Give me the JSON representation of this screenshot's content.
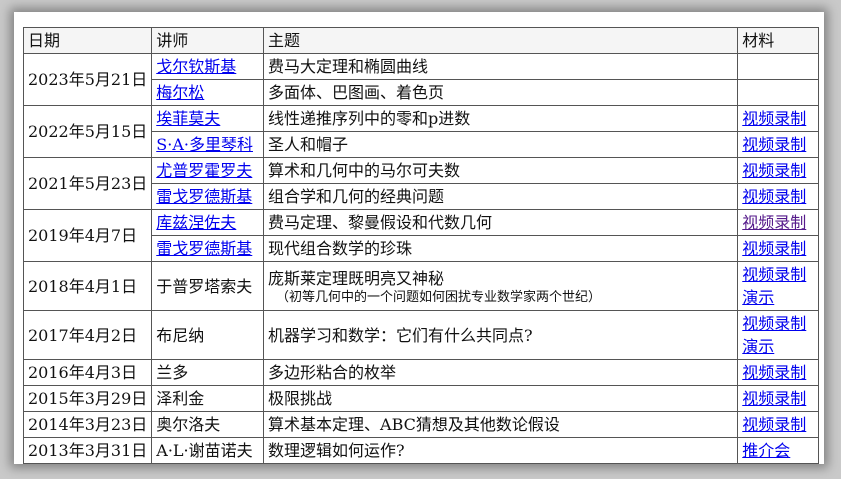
{
  "headers": {
    "date": "日期",
    "lecturer": "讲师",
    "topic": "主题",
    "material": "材料"
  },
  "rows": [
    {
      "date": "2023年5月21日",
      "lecturer": "戈尔钦斯基",
      "topic": "费马大定理和椭圆曲线",
      "material": ""
    },
    {
      "lecturer": "梅尔松",
      "topic": "多面体、巴图画、着色页",
      "material": ""
    },
    {
      "date": "2022年5月15日",
      "lecturer": "埃菲莫夫",
      "topic": "线性递推序列中的零和p进数",
      "material": "视频录制"
    },
    {
      "lecturer": "S·A·多里琴科",
      "topic": "圣人和帽子",
      "material": "视频录制"
    },
    {
      "date": "2021年5月23日",
      "lecturer": "尤普罗霍罗夫",
      "topic": "算术和几何中的马尔可夫数",
      "material": "视频录制"
    },
    {
      "lecturer": "雷戈罗德斯基",
      "topic": "组合学和几何的经典问题",
      "material": "视频录制"
    },
    {
      "date": "2019年4月7日",
      "lecturer": "库兹涅佐夫",
      "topic": "费马定理、黎曼假设和代数几何",
      "material": "视频录制"
    },
    {
      "lecturer": "雷戈罗德斯基",
      "topic": "现代组合数学的珍珠",
      "material": "视频录制"
    },
    {
      "date": "2018年4月1日",
      "lecturer": "于普罗塔索夫",
      "topic": "庞斯莱定理既明亮又神秘",
      "topic_sub": "（初等几何中的一个问题如何困扰专业数学家两个世纪）",
      "material": "视频录制",
      "material2": "演示"
    },
    {
      "date": "2017年4月2日",
      "lecturer": "布尼纳",
      "topic": "机器学习和数学：它们有什么共同点?",
      "material": "视频录制",
      "material2": "演示"
    },
    {
      "date": "2016年4月3日",
      "lecturer": "兰多",
      "topic": "多边形粘合的枚举",
      "material": "视频录制"
    },
    {
      "date": "2015年3月29日",
      "lecturer": "泽利金",
      "topic": "极限挑战",
      "material": "视频录制"
    },
    {
      "date": "2014年3月23日",
      "lecturer": "奥尔洛夫",
      "topic": "算术基本定理、ABC猜想及其他数论假设",
      "material": "视频录制"
    },
    {
      "date": "2013年3月31日",
      "lecturer": "A·L·谢苗诺夫",
      "topic": "数理逻辑如何运作?",
      "material": "推介会"
    }
  ]
}
